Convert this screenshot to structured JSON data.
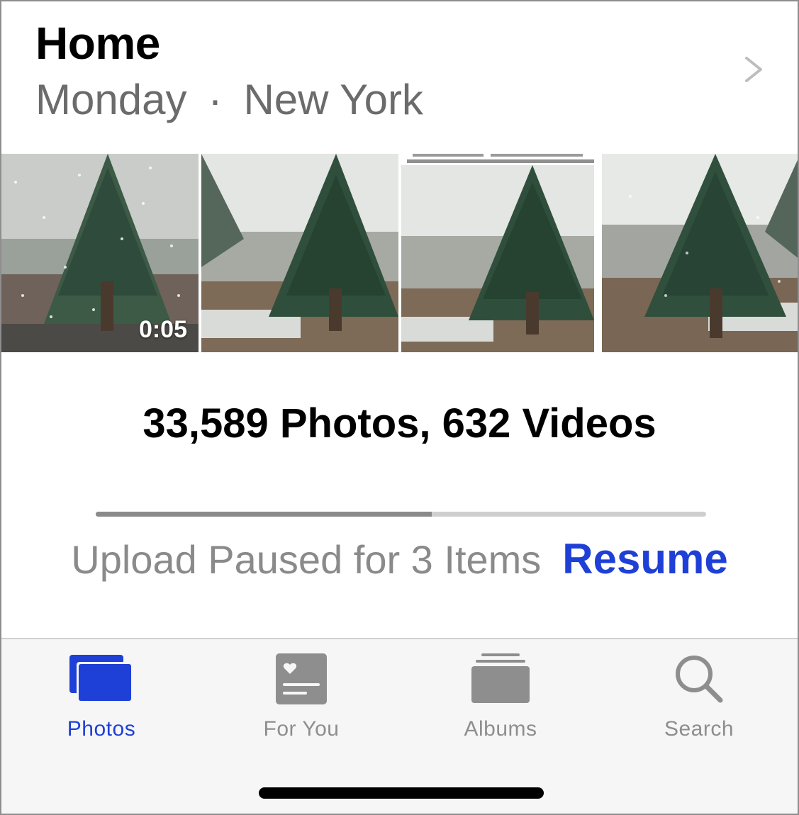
{
  "header": {
    "title": "Home",
    "day": "Monday",
    "separator": "·",
    "location": "New York"
  },
  "thumbnails": [
    {
      "type": "video",
      "duration": "0:05"
    },
    {
      "type": "photo"
    },
    {
      "type": "photo-stack"
    },
    {
      "type": "photo"
    }
  ],
  "library": {
    "counts_text": "33,589 Photos, 632 Videos",
    "upload_progress": 0.55,
    "upload_status": "Upload Paused for 3 Items",
    "resume_label": "Resume"
  },
  "tabbar": {
    "tabs": [
      {
        "label": "Photos",
        "icon": "photos-icon",
        "active": true
      },
      {
        "label": "For You",
        "icon": "for-you-icon",
        "active": false
      },
      {
        "label": "Albums",
        "icon": "albums-icon",
        "active": false
      },
      {
        "label": "Search",
        "icon": "search-icon",
        "active": false
      }
    ]
  },
  "colors": {
    "accent": "#1f40d6",
    "secondary_text": "#6b6b6b",
    "inactive_tab": "#8e8e8e"
  }
}
